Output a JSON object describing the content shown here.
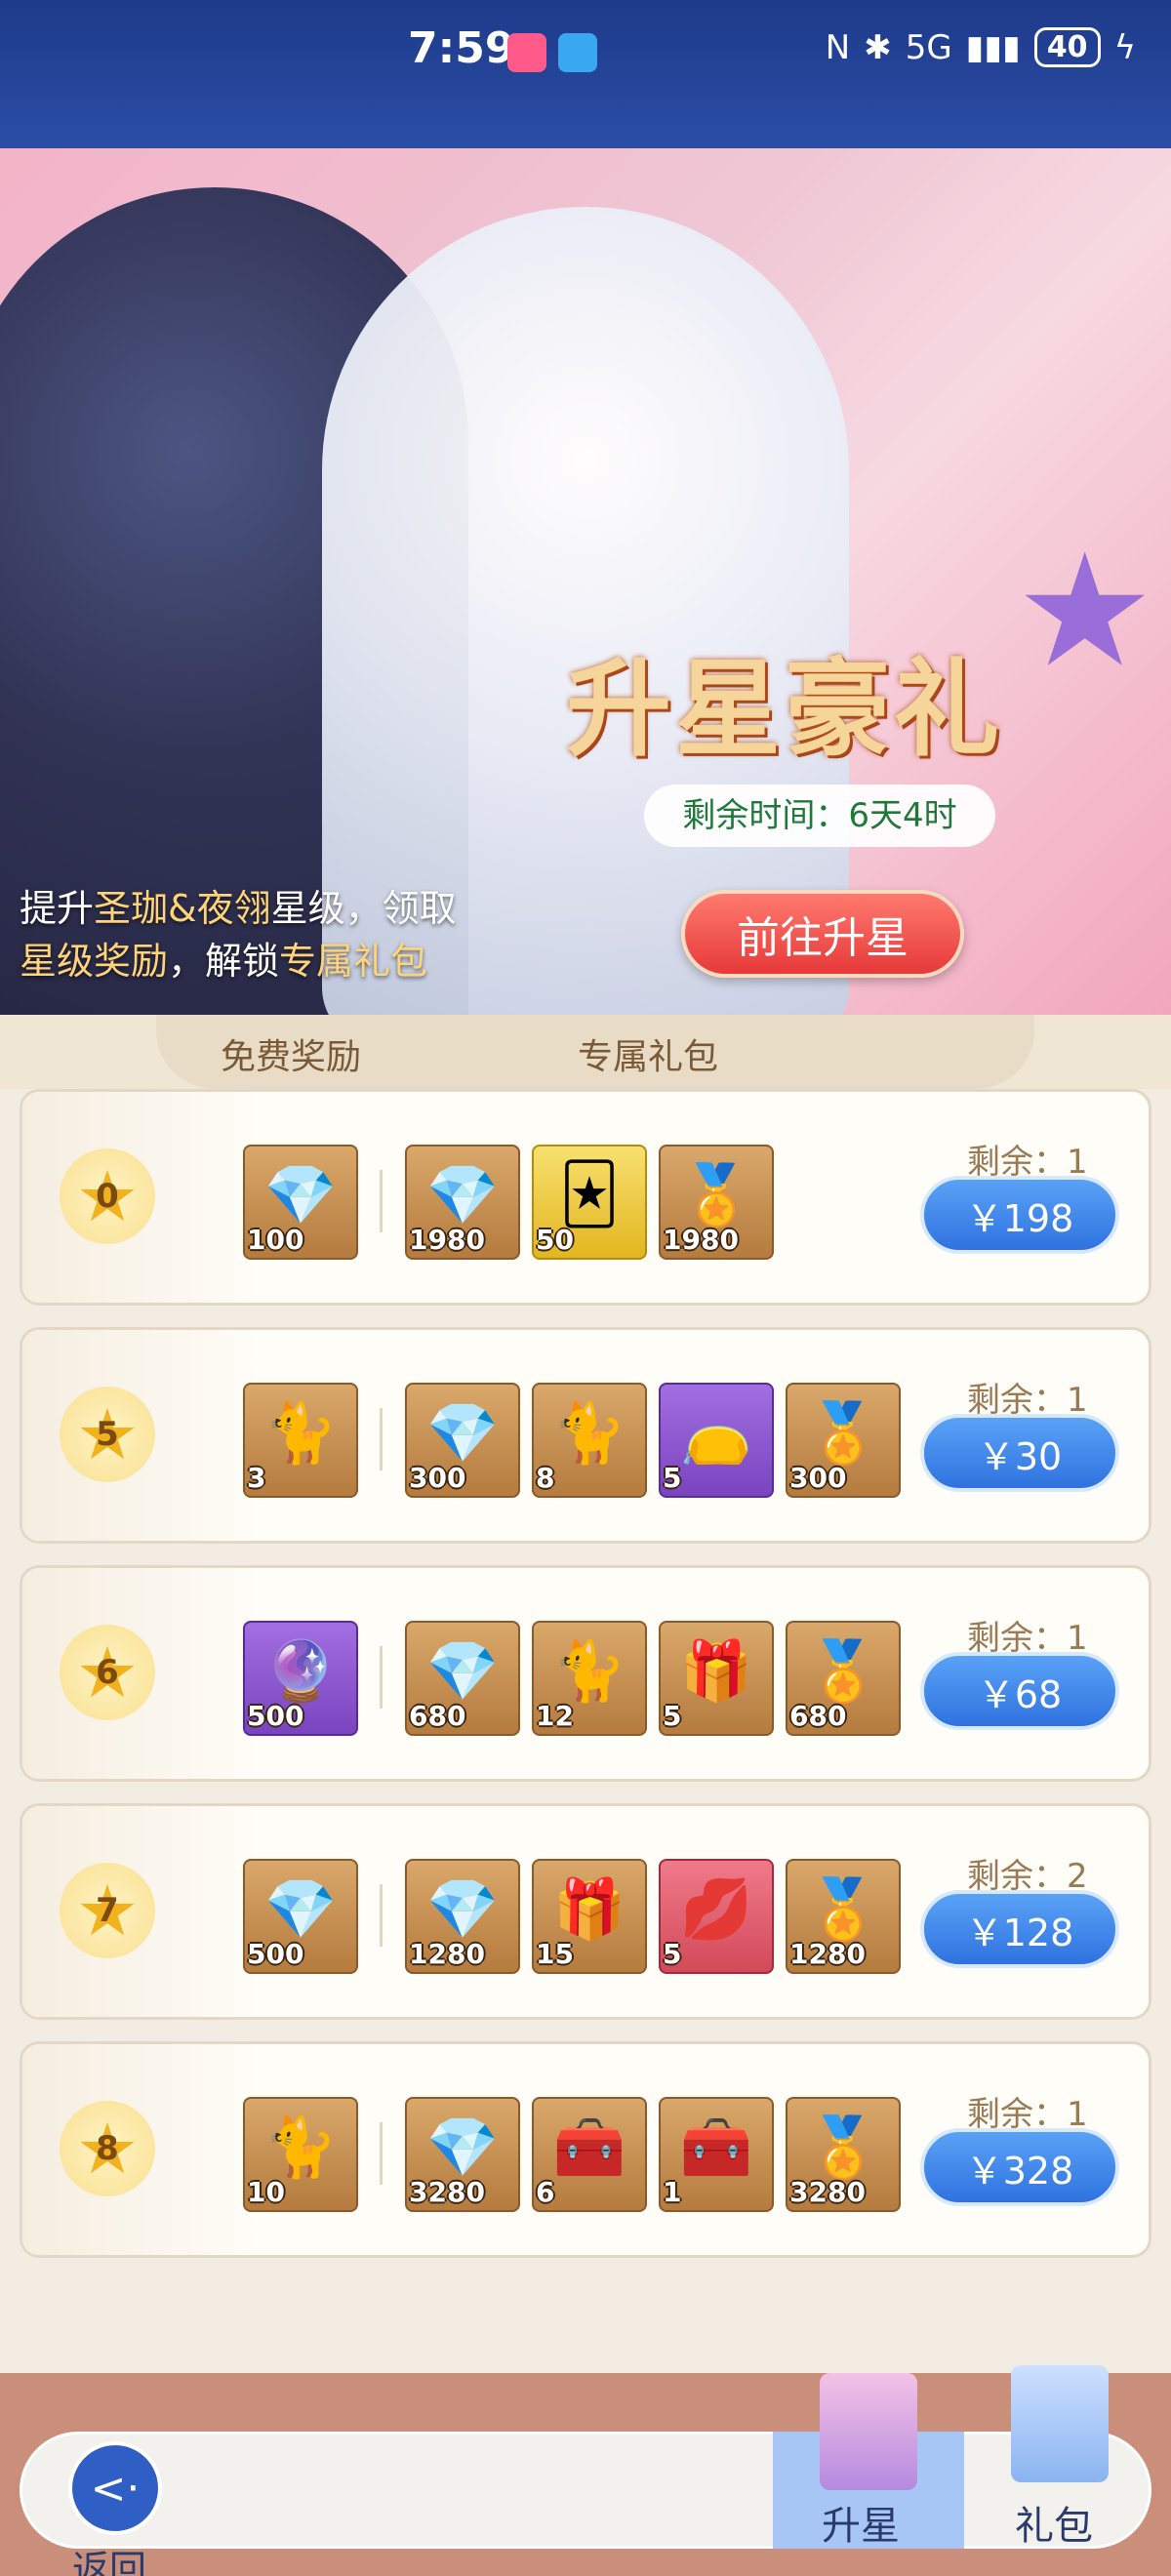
{
  "status_bar": {
    "time": "7:59",
    "signal": "5G",
    "battery": "40"
  },
  "banner": {
    "title": "升星豪礼",
    "timer": "剩余时间：6天4时",
    "description_parts": [
      "提升",
      "圣珈&夜翎",
      "星级，领取",
      "星级奖励",
      "，解锁",
      "专属礼包"
    ],
    "go_button": "前往升星"
  },
  "tabs": {
    "free": "免费奖励",
    "pack": "专属礼包"
  },
  "rows": [
    {
      "level": "0",
      "remain": "剩余：1",
      "price": "￥198",
      "free": {
        "icon": "crystal-icon",
        "qty": "100"
      },
      "items": [
        {
          "icon": "crystal-icon",
          "qty": "1980",
          "style": ""
        },
        {
          "icon": "character-card-icon",
          "qty": "50",
          "style": "gold"
        },
        {
          "icon": "noble-badge-icon",
          "qty": "1980",
          "style": ""
        }
      ]
    },
    {
      "level": "5",
      "remain": "剩余：1",
      "price": "￥30",
      "free": {
        "icon": "black-cat-icon",
        "qty": "3"
      },
      "items": [
        {
          "icon": "crystal-icon",
          "qty": "300",
          "style": ""
        },
        {
          "icon": "black-cat-icon",
          "qty": "8",
          "style": ""
        },
        {
          "icon": "blue-pouch-icon",
          "qty": "5",
          "style": "purple"
        },
        {
          "icon": "noble-badge-icon",
          "qty": "300",
          "style": ""
        }
      ]
    },
    {
      "level": "6",
      "remain": "剩余：1",
      "price": "￥68",
      "free": {
        "icon": "crystal-ball-icon",
        "qty": "500",
        "style": "purple"
      },
      "items": [
        {
          "icon": "crystal-icon",
          "qty": "680",
          "style": ""
        },
        {
          "icon": "black-cat-icon",
          "qty": "12",
          "style": ""
        },
        {
          "icon": "gift-pouch-icon",
          "qty": "5",
          "style": ""
        },
        {
          "icon": "noble-badge-icon",
          "qty": "680",
          "style": ""
        }
      ]
    },
    {
      "level": "7",
      "remain": "剩余：2",
      "price": "￥128",
      "free": {
        "icon": "crystal-icon",
        "qty": "500"
      },
      "items": [
        {
          "icon": "crystal-icon",
          "qty": "1280",
          "style": ""
        },
        {
          "icon": "gift-box-icon",
          "qty": "15",
          "style": ""
        },
        {
          "icon": "lips-icon",
          "qty": "5",
          "style": "pink"
        },
        {
          "icon": "noble-badge-icon",
          "qty": "1280",
          "style": ""
        }
      ]
    },
    {
      "level": "8",
      "remain": "剩余：1",
      "price": "￥328",
      "free": {
        "icon": "black-cat-icon",
        "qty": "10"
      },
      "items": [
        {
          "icon": "crystal-icon",
          "qty": "3280",
          "style": ""
        },
        {
          "icon": "treasure-chest-icon",
          "qty": "6",
          "style": ""
        },
        {
          "icon": "treasure-chest-icon",
          "qty": "1",
          "style": ""
        },
        {
          "icon": "noble-badge-icon",
          "qty": "3280",
          "style": ""
        }
      ]
    }
  ],
  "bottom_nav": {
    "back": "返回",
    "upgrade": "升星",
    "gift": "礼包"
  },
  "colors": {
    "accent_blue": "#2f72e0",
    "go_red": "#e6393a",
    "gold": "#f2b21e"
  }
}
